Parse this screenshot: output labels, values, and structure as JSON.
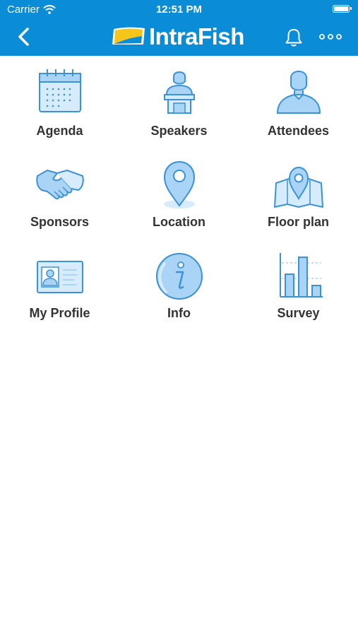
{
  "status_bar": {
    "carrier": "Carrier",
    "time": "12:51 PM"
  },
  "header": {
    "logo_text": "IntraFish",
    "bell_icon": "bell-icon",
    "more_icon": "more-horizontal-icon",
    "back_icon": "chevron-left-icon"
  },
  "colors": {
    "header_bg": "#0a8dd6",
    "icon_fill": "#a9d4f5",
    "icon_stroke": "#3b93d6",
    "logo_yellow": "#f5c518"
  },
  "menu": [
    {
      "label": "Agenda",
      "icon": "calendar-icon"
    },
    {
      "label": "Speakers",
      "icon": "speaker-podium-icon"
    },
    {
      "label": "Attendees",
      "icon": "person-icon"
    },
    {
      "label": "Sponsors",
      "icon": "handshake-icon"
    },
    {
      "label": "Location",
      "icon": "location-pin-icon"
    },
    {
      "label": "Floor plan",
      "icon": "map-pin-icon"
    },
    {
      "label": "My Profile",
      "icon": "id-card-icon"
    },
    {
      "label": "Info",
      "icon": "info-icon"
    },
    {
      "label": "Survey",
      "icon": "bar-chart-icon"
    }
  ]
}
